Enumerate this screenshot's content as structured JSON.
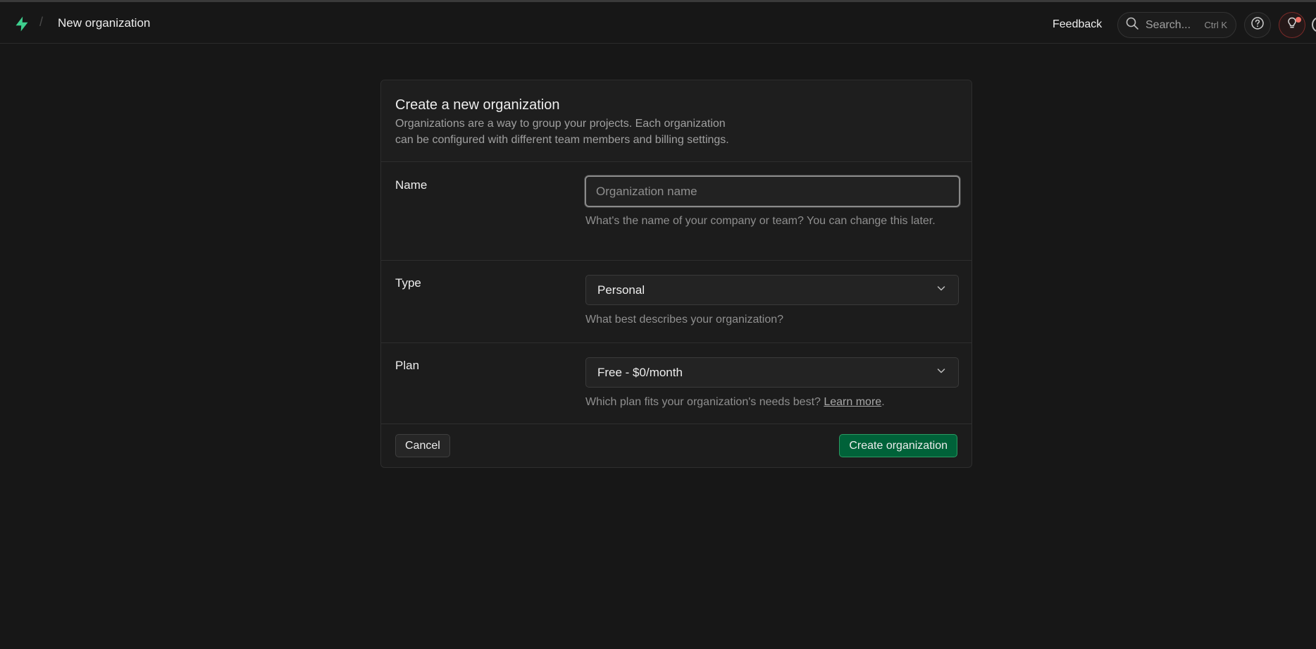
{
  "header": {
    "breadcrumb_separator": "/",
    "page_title": "New organization",
    "feedback_label": "Feedback",
    "search_label": "Search...",
    "search_shortcut": "Ctrl K",
    "icons": {
      "logo": "supabase-bolt-icon",
      "search": "search-icon",
      "help": "help-circle-icon",
      "tips": "lightbulb-icon"
    }
  },
  "form": {
    "title": "Create a new organization",
    "description_line1": "Organizations are a way to group your projects. Each organization",
    "description_line2": "can be configured with different team members and billing settings.",
    "name": {
      "label": "Name",
      "placeholder": "Organization name",
      "value": "",
      "help": "What's the name of your company or team? You can change this later."
    },
    "type": {
      "label": "Type",
      "selected": "Personal",
      "help": "What best describes your organization?"
    },
    "plan": {
      "label": "Plan",
      "selected": "Free - $0/month",
      "help_prefix": "Which plan fits your organization's needs best?",
      "help_link": "Learn more",
      "help_suffix": "."
    },
    "cancel_label": "Cancel",
    "submit_label": "Create organization"
  },
  "colors": {
    "background": "#171717",
    "card": "#1c1c1c",
    "brand": "#3ecf8e",
    "primary_button": "#006239",
    "notification_dot": "#f07066"
  }
}
